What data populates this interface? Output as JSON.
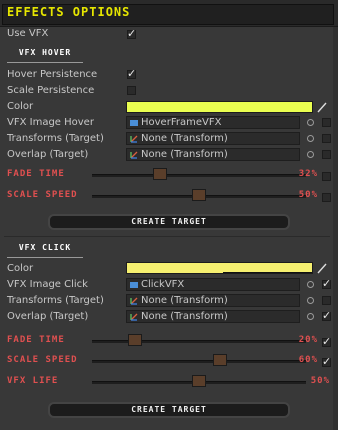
{
  "header": {
    "title": "EFFECTS OPTIONS"
  },
  "use_vfx": {
    "label": "Use VFX",
    "checked": true
  },
  "vfx_hover": {
    "section_label": "VFX HOVER",
    "hover_persistence": {
      "label": "Hover Persistence",
      "checked": true
    },
    "scale_persistence": {
      "label": "Scale Persistence",
      "checked": false
    },
    "color": {
      "label": "Color",
      "value": "#eaff50"
    },
    "vfx_image": {
      "label": "VFX Image Hover",
      "value": "HoverFrameVFX",
      "checked": false
    },
    "transforms": {
      "label": "Transforms (Target)",
      "value": "None (Transform)",
      "checked": false
    },
    "overlap": {
      "label": "Overlap (Target)",
      "value": "None (Transform)",
      "checked": false
    },
    "fade_time": {
      "label": "FADE TIME",
      "value_text": "32%",
      "value": 0.32,
      "checked": false
    },
    "scale_speed": {
      "label": "SCALE SPEED",
      "value_text": "50%",
      "value": 0.5,
      "checked": false
    },
    "create_button": "CREATE TARGET"
  },
  "vfx_click": {
    "section_label": "VFX CLICK",
    "color": {
      "label": "Color",
      "value": "#f6f070"
    },
    "vfx_image": {
      "label": "VFX Image Click",
      "value": "ClickVFX",
      "checked": true
    },
    "transforms": {
      "label": "Transforms (Target)",
      "value": "None (Transform)",
      "checked": false
    },
    "overlap": {
      "label": "Overlap (Target)",
      "value": "None (Transform)",
      "checked": true
    },
    "fade_time": {
      "label": "FADE TIME",
      "value_text": "20%",
      "value": 0.2,
      "checked": true
    },
    "scale_speed": {
      "label": "SCALE SPEED",
      "value_text": "60%",
      "value": 0.6,
      "checked": true
    },
    "vfx_life": {
      "label": "VFX LIFE",
      "value_text": "50%",
      "value": 0.5
    },
    "create_button": "CREATE TARGET"
  },
  "icons": {
    "image": "sprite-icon",
    "transform": "transform-icon",
    "picker": "object-picker-icon",
    "eyedropper": "eyedropper-icon"
  }
}
